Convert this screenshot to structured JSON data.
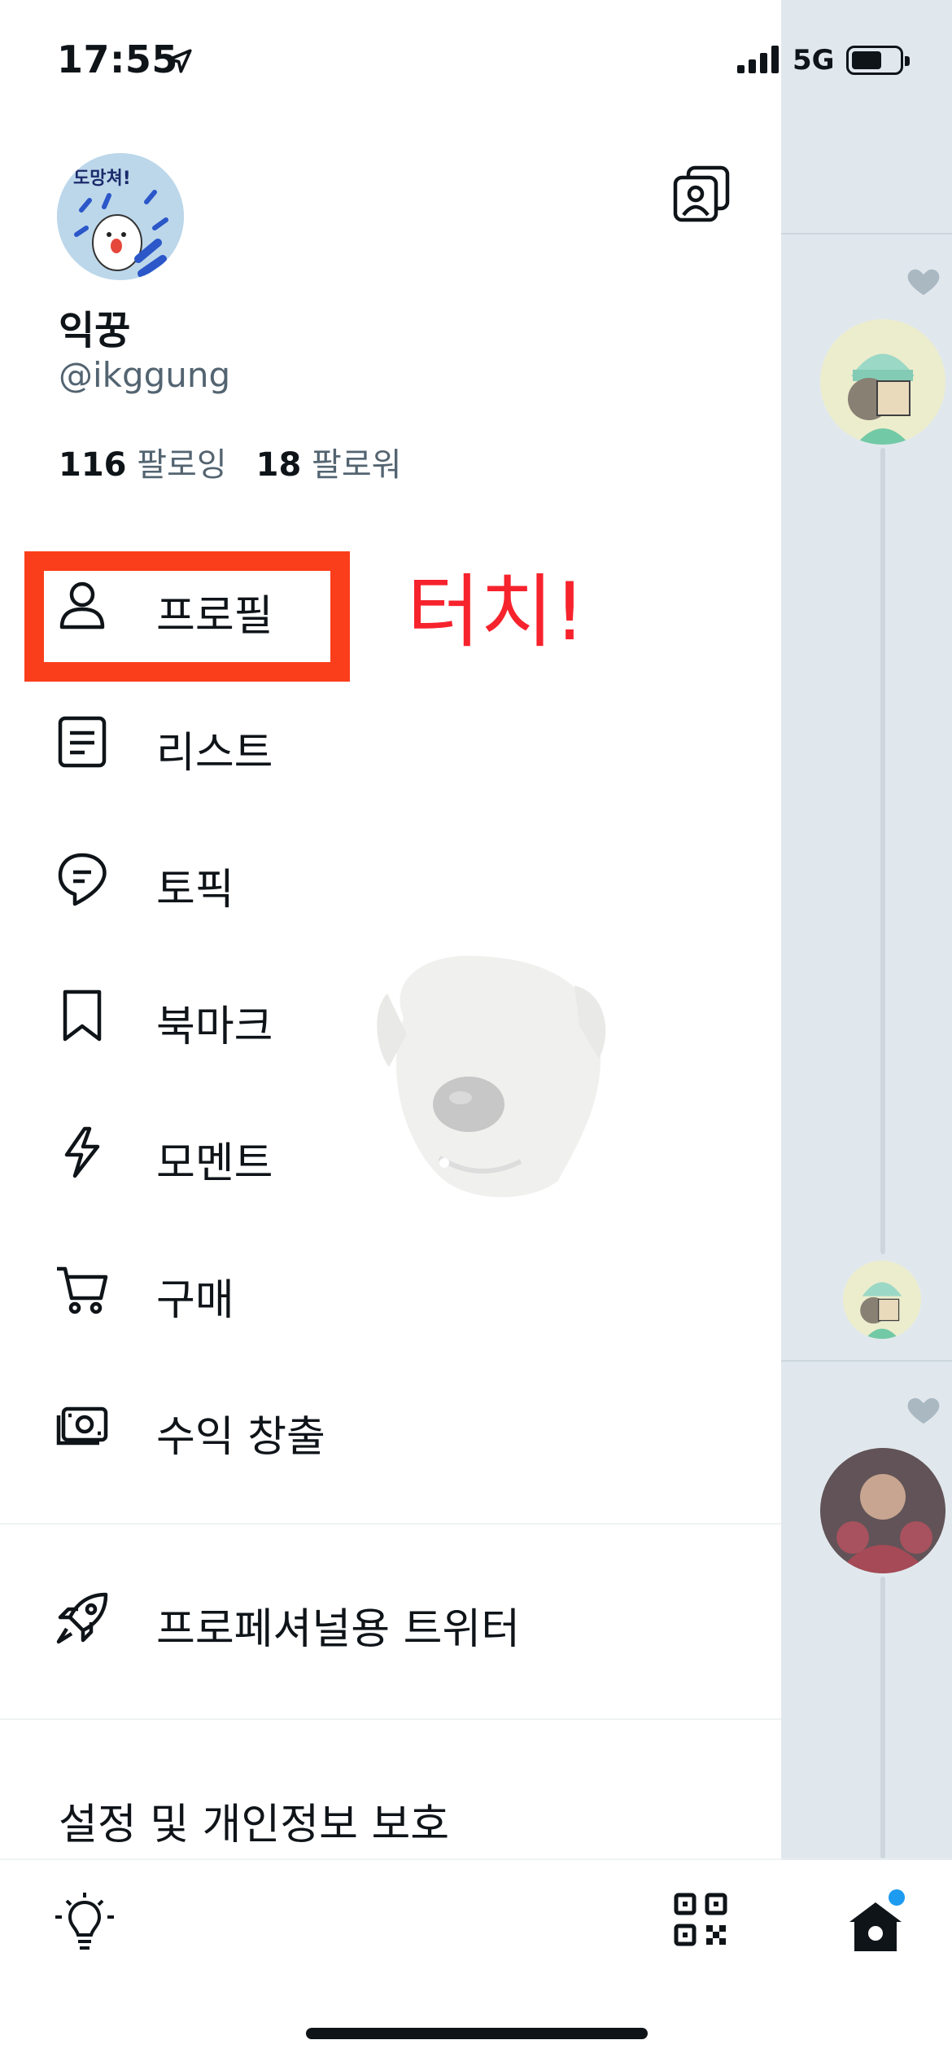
{
  "status_bar": {
    "time": "17:55",
    "network": "5G"
  },
  "profile": {
    "display_name": "익꿍",
    "handle": "@ikggung",
    "following_count": "116",
    "following_label": "팔로잉",
    "followers_count": "18",
    "followers_label": "팔로워"
  },
  "menu": {
    "items": [
      {
        "label": "프로필",
        "icon": "person-icon"
      },
      {
        "label": "리스트",
        "icon": "list-icon"
      },
      {
        "label": "토픽",
        "icon": "topic-icon"
      },
      {
        "label": "북마크",
        "icon": "bookmark-icon"
      },
      {
        "label": "모멘트",
        "icon": "moments-icon"
      },
      {
        "label": "구매",
        "icon": "cart-icon"
      },
      {
        "label": "수익 창출",
        "icon": "money-icon"
      }
    ],
    "professional": "프로페셔널용 트위터",
    "settings": "설정 및 개인정보 보호"
  },
  "annotation": {
    "touch_text": "터치!",
    "highlight_color": "#fa3e1b",
    "text_color": "#f6232d"
  },
  "colors": {
    "primary_text": "#0f1419",
    "secondary_text": "#536471",
    "accent": "#1d9bf0",
    "timeline_bg": "#e1e8ed"
  }
}
